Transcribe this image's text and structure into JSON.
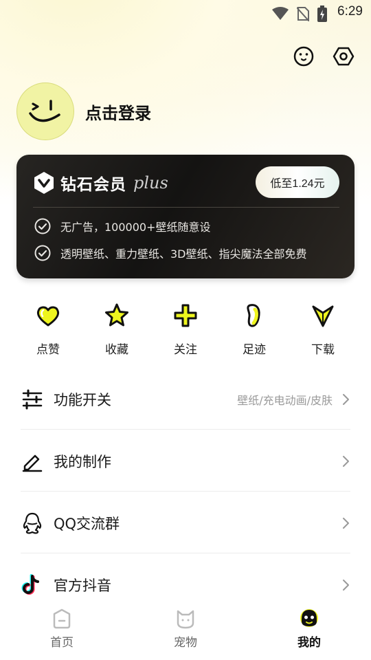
{
  "status": {
    "time": "6:29"
  },
  "profile": {
    "login": "点击登录"
  },
  "vip": {
    "title": "钻石会员",
    "plus": "plus",
    "button": "低至1.24元",
    "benefits": [
      "无广告，100000+壁纸随意设",
      "透明壁纸、重力壁纸、3D壁纸、指尖魔法全部免费"
    ]
  },
  "quick": [
    {
      "label": "点赞",
      "icon": "heart-icon"
    },
    {
      "label": "收藏",
      "icon": "star-icon"
    },
    {
      "label": "关注",
      "icon": "plus-icon"
    },
    {
      "label": "足迹",
      "icon": "footprint-icon"
    },
    {
      "label": "下载",
      "icon": "download-icon"
    }
  ],
  "menu": [
    {
      "label": "功能开关",
      "sub": "壁纸/充电动画/皮肤",
      "icon": "sliders-icon"
    },
    {
      "label": "我的制作",
      "sub": "",
      "icon": "pen-icon"
    },
    {
      "label": "QQ交流群",
      "sub": "",
      "icon": "qq-icon"
    },
    {
      "label": "官方抖音",
      "sub": "",
      "icon": "tiktok-icon"
    }
  ],
  "tabs": [
    {
      "label": "首页",
      "icon": "home-icon"
    },
    {
      "label": "宠物",
      "icon": "pet-icon"
    },
    {
      "label": "我的",
      "icon": "me-icon",
      "active": true
    }
  ],
  "colors": {
    "accent": "#e8f21c",
    "card": "#1a1918"
  }
}
